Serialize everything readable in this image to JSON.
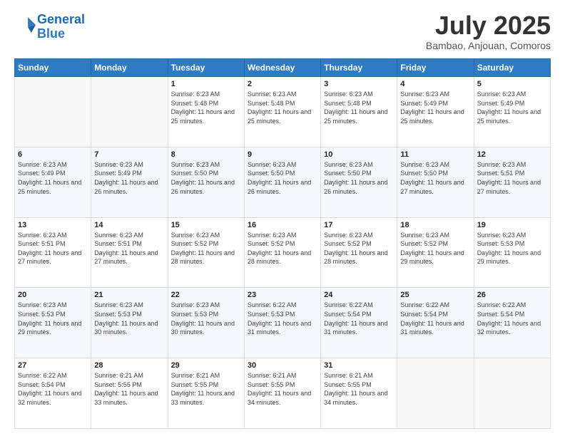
{
  "header": {
    "logo_line1": "General",
    "logo_line2": "Blue",
    "month": "July 2025",
    "location": "Bambao, Anjouan, Comoros"
  },
  "days_of_week": [
    "Sunday",
    "Monday",
    "Tuesday",
    "Wednesday",
    "Thursday",
    "Friday",
    "Saturday"
  ],
  "weeks": [
    [
      {
        "day": "",
        "info": ""
      },
      {
        "day": "",
        "info": ""
      },
      {
        "day": "1",
        "info": "Sunrise: 6:23 AM\nSunset: 5:48 PM\nDaylight: 11 hours and 25 minutes."
      },
      {
        "day": "2",
        "info": "Sunrise: 6:23 AM\nSunset: 5:48 PM\nDaylight: 11 hours and 25 minutes."
      },
      {
        "day": "3",
        "info": "Sunrise: 6:23 AM\nSunset: 5:48 PM\nDaylight: 11 hours and 25 minutes."
      },
      {
        "day": "4",
        "info": "Sunrise: 6:23 AM\nSunset: 5:49 PM\nDaylight: 11 hours and 25 minutes."
      },
      {
        "day": "5",
        "info": "Sunrise: 6:23 AM\nSunset: 5:49 PM\nDaylight: 11 hours and 25 minutes."
      }
    ],
    [
      {
        "day": "6",
        "info": "Sunrise: 6:23 AM\nSunset: 5:49 PM\nDaylight: 11 hours and 25 minutes."
      },
      {
        "day": "7",
        "info": "Sunrise: 6:23 AM\nSunset: 5:49 PM\nDaylight: 11 hours and 26 minutes."
      },
      {
        "day": "8",
        "info": "Sunrise: 6:23 AM\nSunset: 5:50 PM\nDaylight: 11 hours and 26 minutes."
      },
      {
        "day": "9",
        "info": "Sunrise: 6:23 AM\nSunset: 5:50 PM\nDaylight: 11 hours and 26 minutes."
      },
      {
        "day": "10",
        "info": "Sunrise: 6:23 AM\nSunset: 5:50 PM\nDaylight: 11 hours and 26 minutes."
      },
      {
        "day": "11",
        "info": "Sunrise: 6:23 AM\nSunset: 5:50 PM\nDaylight: 11 hours and 27 minutes."
      },
      {
        "day": "12",
        "info": "Sunrise: 6:23 AM\nSunset: 5:51 PM\nDaylight: 11 hours and 27 minutes."
      }
    ],
    [
      {
        "day": "13",
        "info": "Sunrise: 6:23 AM\nSunset: 5:51 PM\nDaylight: 11 hours and 27 minutes."
      },
      {
        "day": "14",
        "info": "Sunrise: 6:23 AM\nSunset: 5:51 PM\nDaylight: 11 hours and 27 minutes."
      },
      {
        "day": "15",
        "info": "Sunrise: 6:23 AM\nSunset: 5:52 PM\nDaylight: 11 hours and 28 minutes."
      },
      {
        "day": "16",
        "info": "Sunrise: 6:23 AM\nSunset: 5:52 PM\nDaylight: 11 hours and 28 minutes."
      },
      {
        "day": "17",
        "info": "Sunrise: 6:23 AM\nSunset: 5:52 PM\nDaylight: 11 hours and 28 minutes."
      },
      {
        "day": "18",
        "info": "Sunrise: 6:23 AM\nSunset: 5:52 PM\nDaylight: 11 hours and 29 minutes."
      },
      {
        "day": "19",
        "info": "Sunrise: 6:23 AM\nSunset: 5:53 PM\nDaylight: 11 hours and 29 minutes."
      }
    ],
    [
      {
        "day": "20",
        "info": "Sunrise: 6:23 AM\nSunset: 5:53 PM\nDaylight: 11 hours and 29 minutes."
      },
      {
        "day": "21",
        "info": "Sunrise: 6:23 AM\nSunset: 5:53 PM\nDaylight: 11 hours and 30 minutes."
      },
      {
        "day": "22",
        "info": "Sunrise: 6:23 AM\nSunset: 5:53 PM\nDaylight: 11 hours and 30 minutes."
      },
      {
        "day": "23",
        "info": "Sunrise: 6:22 AM\nSunset: 5:53 PM\nDaylight: 11 hours and 31 minutes."
      },
      {
        "day": "24",
        "info": "Sunrise: 6:22 AM\nSunset: 5:54 PM\nDaylight: 11 hours and 31 minutes."
      },
      {
        "day": "25",
        "info": "Sunrise: 6:22 AM\nSunset: 5:54 PM\nDaylight: 11 hours and 31 minutes."
      },
      {
        "day": "26",
        "info": "Sunrise: 6:22 AM\nSunset: 5:54 PM\nDaylight: 11 hours and 32 minutes."
      }
    ],
    [
      {
        "day": "27",
        "info": "Sunrise: 6:22 AM\nSunset: 5:54 PM\nDaylight: 11 hours and 32 minutes."
      },
      {
        "day": "28",
        "info": "Sunrise: 6:21 AM\nSunset: 5:55 PM\nDaylight: 11 hours and 33 minutes."
      },
      {
        "day": "29",
        "info": "Sunrise: 6:21 AM\nSunset: 5:55 PM\nDaylight: 11 hours and 33 minutes."
      },
      {
        "day": "30",
        "info": "Sunrise: 6:21 AM\nSunset: 5:55 PM\nDaylight: 11 hours and 34 minutes."
      },
      {
        "day": "31",
        "info": "Sunrise: 6:21 AM\nSunset: 5:55 PM\nDaylight: 11 hours and 34 minutes."
      },
      {
        "day": "",
        "info": ""
      },
      {
        "day": "",
        "info": ""
      }
    ]
  ]
}
